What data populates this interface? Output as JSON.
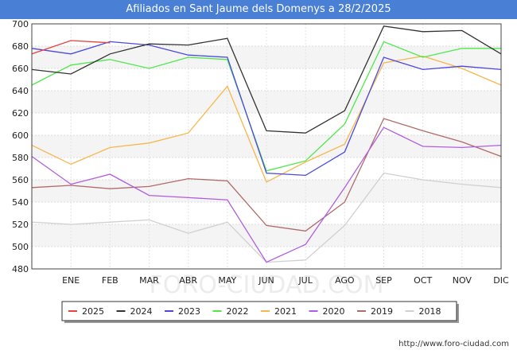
{
  "chart_data": {
    "type": "line",
    "title": "Afiliados en Sant Jaume dels Domenys a 28/2/2025",
    "categories": [
      "ENE",
      "FEB",
      "MAR",
      "ABR",
      "MAY",
      "JUN",
      "JUL",
      "AGO",
      "SEP",
      "OCT",
      "NOV",
      "DIC"
    ],
    "ylim": [
      480,
      700
    ],
    "yticks": [
      480,
      500,
      520,
      540,
      560,
      580,
      600,
      620,
      640,
      660,
      680,
      700
    ],
    "grid": true,
    "legend_position": "bottom",
    "watermark": "FORO-CIUDAD.COM",
    "series": [
      {
        "name": "2025",
        "color": "#e8413e",
        "values": [
          673,
          685,
          683
        ]
      },
      {
        "name": "2024",
        "color": "#333333",
        "values": [
          659,
          655,
          673,
          682,
          681,
          687,
          604,
          602,
          622,
          698,
          693,
          694,
          673
        ]
      },
      {
        "name": "2023",
        "color": "#4b48e0",
        "values": [
          678,
          673,
          684,
          681,
          672,
          670,
          566,
          564,
          585,
          670,
          659,
          662,
          659
        ]
      },
      {
        "name": "2022",
        "color": "#4ee84a",
        "values": [
          645,
          663,
          668,
          660,
          670,
          668,
          568,
          577,
          610,
          684,
          670,
          678,
          678
        ]
      },
      {
        "name": "2021",
        "color": "#f6b84d",
        "values": [
          591,
          574,
          589,
          593,
          602,
          644,
          558,
          576,
          592,
          665,
          671,
          660,
          645
        ]
      },
      {
        "name": "2020",
        "color": "#b05de0",
        "values": [
          581,
          556,
          565,
          546,
          544,
          542,
          486,
          502,
          553,
          607,
          590,
          589,
          591
        ]
      },
      {
        "name": "2019",
        "color": "#b06a6a",
        "values": [
          553,
          555,
          552,
          554,
          561,
          559,
          519,
          514,
          540,
          615,
          604,
          594,
          581
        ]
      },
      {
        "name": "2018",
        "color": "#d0d0d0",
        "values": [
          522,
          520,
          522,
          524,
          512,
          522,
          486,
          488,
          519,
          566,
          560,
          556,
          553
        ]
      }
    ]
  },
  "footer": {
    "source": "http://www.foro-ciudad.com"
  }
}
